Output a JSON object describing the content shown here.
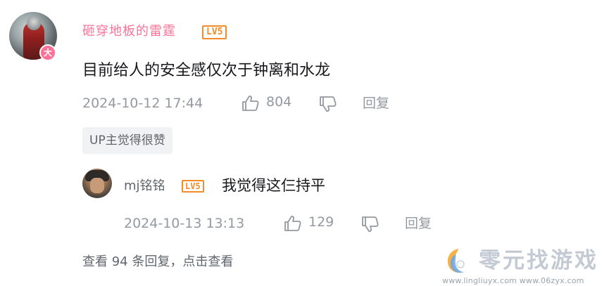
{
  "comment": {
    "username": "砸穿地板的雷霆",
    "level": "LV5",
    "avatar_badge": "大",
    "text": "目前给人的安全感仅次于钟离和水龙",
    "date": "2024-10-12 17:44",
    "like_count": "804",
    "reply_label": "回复",
    "up_tag": "UP主觉得很赞"
  },
  "reply": {
    "username": "mj铭铭",
    "level": "LV5",
    "text": "我觉得这仨持平",
    "date": "2024-10-13 13:13",
    "like_count": "129",
    "reply_label": "回复"
  },
  "view_more": "查看 94 条回复，点击查看",
  "watermark": {
    "title": "零元找游戏",
    "url": "www.lingliuyx.com    www.06zyx.com"
  },
  "colors": {
    "username_accent": "#fb7299",
    "level_badge": "#f28b28",
    "meta_text": "#9499a0",
    "tag_bg": "#f1f2f3"
  },
  "icons": [
    "like-icon",
    "dislike-icon",
    "logo-icon"
  ]
}
